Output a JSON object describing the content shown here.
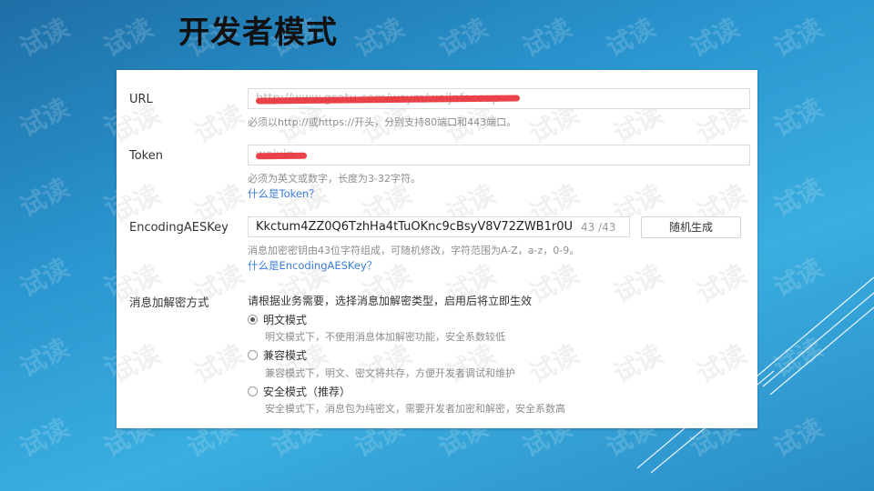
{
  "slide": {
    "title": "开发者模式"
  },
  "watermark": {
    "text": "试读"
  },
  "form": {
    "url": {
      "label": "URL",
      "value": "http://www.gsatu.com/wsym/weiJnfocoup",
      "hint": "必须以http://或https://开头，分别支持80端口和443端口。"
    },
    "token": {
      "label": "Token",
      "value": "weixin",
      "hint": "必须为英文或数字，长度为3-32字符。",
      "help_link": "什么是Token？"
    },
    "aes": {
      "label": "EncodingAESKey",
      "value": "Kkctum4ZZ0Q6TzhHa4tTuOKnc9cBsyV8V72ZWB1r0U",
      "counter": "43 /43",
      "random_button": "随机生成",
      "hint": "消息加密密钥由43位字符组成，可随机修改，字符范围为A-Z，a-z，0-9。",
      "help_link": "什么是EncodingAESKey？"
    },
    "encryption": {
      "label": "消息加解密方式",
      "description": "请根据业务需要，选择消息加解密类型，启用后将立即生效",
      "options": [
        {
          "label": "明文模式",
          "desc": "明文模式下，不使用消息体加解密功能，安全系数较低",
          "checked": true
        },
        {
          "label": "兼容模式",
          "desc": "兼容模式下，明文、密文将共存，方便开发者调试和维护",
          "checked": false
        },
        {
          "label": "安全模式（推荐）",
          "desc": "安全模式下，消息包为纯密文，需要开发者加密和解密，安全系数高",
          "checked": false
        }
      ]
    }
  }
}
